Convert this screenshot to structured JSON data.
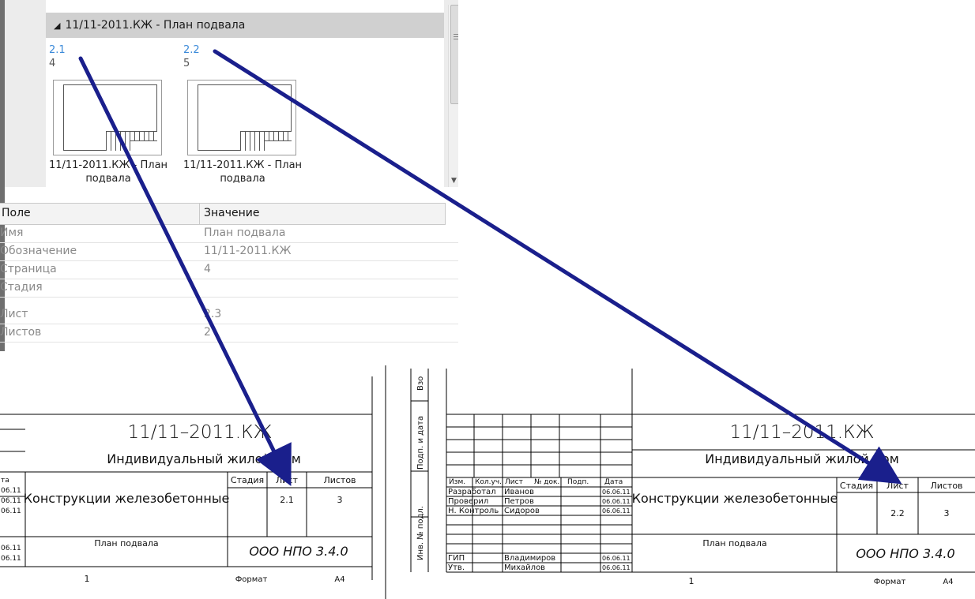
{
  "sheet_browser": {
    "group_title": "11/11-2011.КЖ - План подвала",
    "thumbnails": [
      {
        "number": "2.1",
        "page": "4",
        "caption_line1": "11/11-2011.КЖ - План",
        "caption_line2": "подвала"
      },
      {
        "number": "2.2",
        "page": "5",
        "caption_line1": "11/11-2011.КЖ - План",
        "caption_line2": "подвала"
      }
    ]
  },
  "properties": {
    "header_field": "Поле",
    "header_value": "Значение",
    "rows": [
      {
        "field": "Имя",
        "value": "План подвала"
      },
      {
        "field": "Обозначение",
        "value": "11/11-2011.КЖ"
      },
      {
        "field": "Страница",
        "value": "4"
      },
      {
        "field": "Стадия",
        "value": ""
      },
      {
        "field": "Лист",
        "value": "2.3"
      },
      {
        "field": "Листов",
        "value": "2"
      }
    ]
  },
  "left_drawing": {
    "code": "11/11–2011.КЖ",
    "project": "Индивидуальный жилой дом",
    "part": "Конструкции железобетонные",
    "col_stage": "Стадия",
    "col_sheet": "Лист",
    "col_sheets": "Листов",
    "sheet": "2.1",
    "sheets": "3",
    "drawing_name": "План подвала",
    "company": "ООО НПО 3.4.0",
    "page": "1",
    "format_label": "Формат",
    "format": "А4",
    "side_date": "та",
    "side_dates": [
      "06.11",
      "06.11",
      "06.11",
      "06.11",
      "06.11"
    ]
  },
  "right_drawing": {
    "code": "11/11–2011.КЖ",
    "project": "Индивидуальный жилой дом",
    "part": "Конструкции железобетонные",
    "col_stage": "Стадия",
    "col_sheet": "Лист",
    "col_sheets": "Листов",
    "sheet": "2.2",
    "sheets": "3",
    "drawing_name": "План подвала",
    "company": "ООО НПО 3.4.0",
    "page": "1",
    "format_label": "Формат",
    "format": "А4",
    "vert_labels": [
      "Взо",
      "Подп. и дата",
      "Инв. № подл."
    ],
    "stamp_headers": [
      "Изм.",
      "Кол.уч.",
      "Лист",
      "№ док.",
      "Подп.",
      "Дата"
    ],
    "people": [
      {
        "role": "Разработал",
        "name": "Иванов",
        "date": "06.06.11"
      },
      {
        "role": "Проверил",
        "name": "Петров",
        "date": "06.06.11"
      },
      {
        "role": "Н. Контроль",
        "name": "Сидоров",
        "date": "06.06.11"
      },
      {
        "role": "",
        "name": "",
        "date": ""
      },
      {
        "role": "ГИП",
        "name": "Владимиров",
        "date": "06.06.11"
      },
      {
        "role": "Утв.",
        "name": "Михайлов",
        "date": "06.06.11"
      }
    ]
  },
  "colors": {
    "arrow": "#1a1f8c",
    "link": "#3b8ad9",
    "header_bg": "#d0d0d0"
  }
}
